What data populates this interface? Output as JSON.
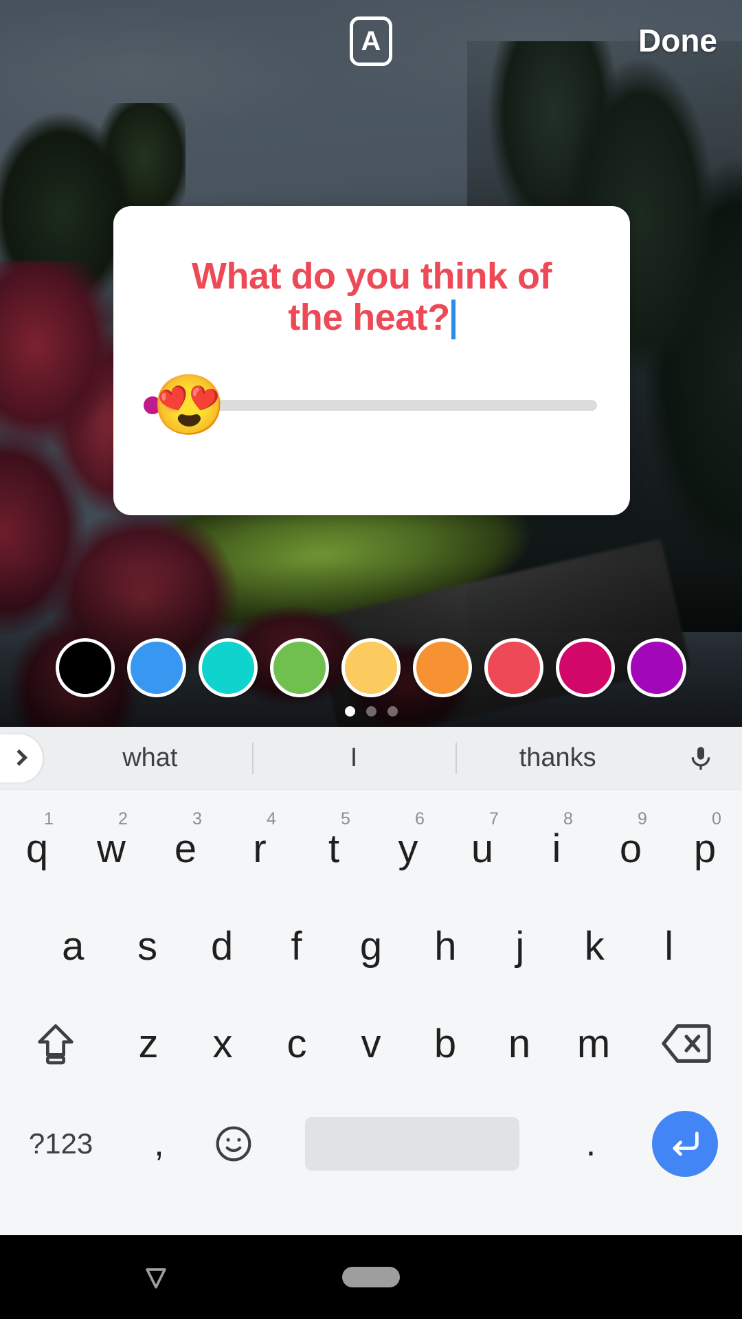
{
  "topbar": {
    "font_button_label": "A",
    "font_button_icon": "text-style-icon",
    "done_label": "Done"
  },
  "sticker": {
    "type": "emoji-slider",
    "question_line1": "What do you think of",
    "question_line2": "the heat?",
    "question_full": "What do you think of the heat?",
    "text_color": "#ED4956",
    "caret_color": "#2A8CF0",
    "card_background": "#FFFFFF",
    "slider": {
      "emoji": "😍",
      "emoji_name": "smiling-face-with-heart-eyes",
      "value_percent": 0,
      "track_color": "#DCDCDC"
    }
  },
  "palette": {
    "selected_index": 6,
    "swatches": [
      {
        "name": "black",
        "hex": "#000000"
      },
      {
        "name": "blue",
        "hex": "#3897F0"
      },
      {
        "name": "teal",
        "hex": "#0FD3CD"
      },
      {
        "name": "green",
        "hex": "#70C050"
      },
      {
        "name": "yellow",
        "hex": "#FCCB5F"
      },
      {
        "name": "orange",
        "hex": "#F79232"
      },
      {
        "name": "red",
        "hex": "#ED4956"
      },
      {
        "name": "magenta",
        "hex": "#D10869"
      },
      {
        "name": "purple",
        "hex": "#A307BA"
      }
    ],
    "page_dots": {
      "count": 3,
      "active": 0
    }
  },
  "keyboard": {
    "suggestions": [
      "what",
      "I",
      "thanks"
    ],
    "expand_icon": "chevron-right-icon",
    "mic_icon": "microphone-icon",
    "row1": [
      {
        "key": "q",
        "num": "1"
      },
      {
        "key": "w",
        "num": "2"
      },
      {
        "key": "e",
        "num": "3"
      },
      {
        "key": "r",
        "num": "4"
      },
      {
        "key": "t",
        "num": "5"
      },
      {
        "key": "y",
        "num": "6"
      },
      {
        "key": "u",
        "num": "7"
      },
      {
        "key": "i",
        "num": "8"
      },
      {
        "key": "o",
        "num": "9"
      },
      {
        "key": "p",
        "num": "0"
      }
    ],
    "row2": [
      "a",
      "s",
      "d",
      "f",
      "g",
      "h",
      "j",
      "k",
      "l"
    ],
    "row3": [
      "z",
      "x",
      "c",
      "v",
      "b",
      "n",
      "m"
    ],
    "shift_icon": "shift-up-arrow-icon",
    "backspace_icon": "backspace-delete-icon",
    "row4": {
      "symbols_label": "?123",
      "comma_label": ",",
      "emoji_icon": "emoji-smiley-icon",
      "space_label": "",
      "period_label": ".",
      "enter_icon": "enter-return-icon",
      "enter_color": "#4285F4"
    }
  },
  "navbar": {
    "back_icon": "hide-keyboard-down-arrow-icon",
    "home_icon": "home-pill-icon"
  }
}
